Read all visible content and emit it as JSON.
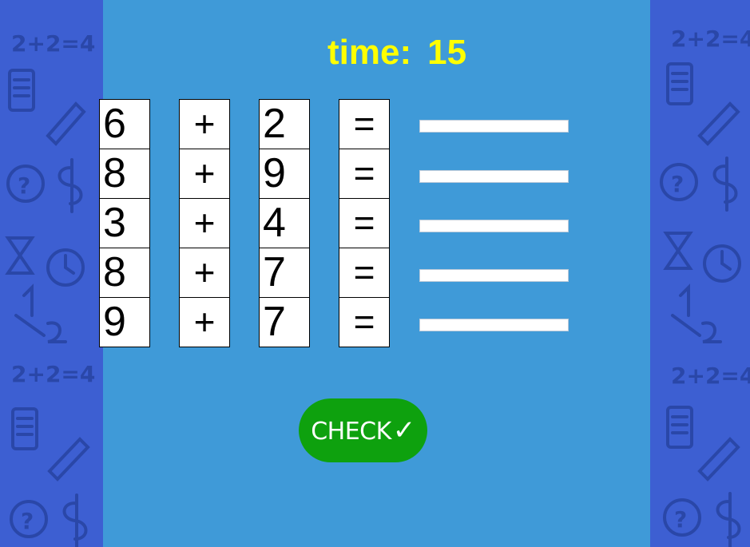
{
  "timer": {
    "label": "time:",
    "value": "15",
    "color": "#ffff00"
  },
  "equations": [
    {
      "a": "6",
      "op": "+",
      "b": "2",
      "eq": "=",
      "answer": ""
    },
    {
      "a": "8",
      "op": "+",
      "b": "9",
      "eq": "=",
      "answer": ""
    },
    {
      "a": "3",
      "op": "+",
      "b": "4",
      "eq": "=",
      "answer": ""
    },
    {
      "a": "8",
      "op": "+",
      "b": "7",
      "eq": "=",
      "answer": ""
    },
    {
      "a": "9",
      "op": "+",
      "b": "7",
      "eq": "=",
      "answer": ""
    }
  ],
  "check_button": {
    "label": "CHECK",
    "icon": "checkmark-icon",
    "tick": "✓",
    "color": "#0ea10e"
  },
  "side_decoration": {
    "doodle_text": "2+2=4",
    "half": "1/2",
    "dollar": "$",
    "question": "?"
  },
  "colors": {
    "panel": "#3f9ad8",
    "side": "#3d5fd2",
    "doodle": "#2a47a8"
  }
}
